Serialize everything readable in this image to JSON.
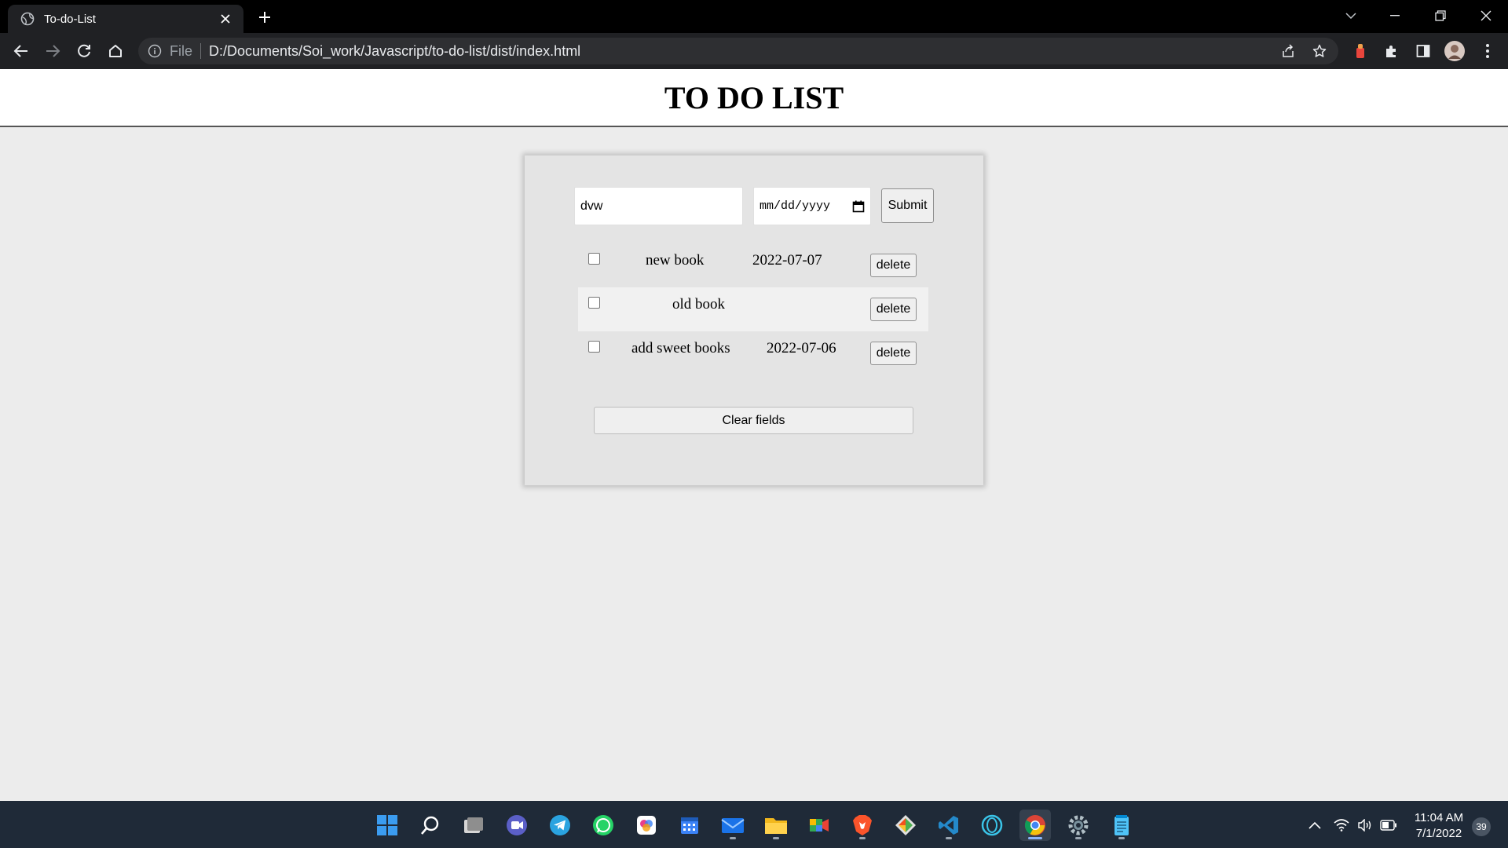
{
  "browser": {
    "tab_title": "To-do-List",
    "address_scheme": "File",
    "address_url": "D:/Documents/Soi_work/Javascript/to-do-list/dist/index.html"
  },
  "page": {
    "title": "TO DO LIST"
  },
  "form": {
    "task_value": "dvw",
    "date_placeholder": "mm/dd/yyyy",
    "submit_label": "Submit"
  },
  "tasks": [
    {
      "name": "new book",
      "date": "2022-07-07",
      "checked": false,
      "delete_label": "delete"
    },
    {
      "name": "old book",
      "date": "",
      "checked": false,
      "delete_label": "delete"
    },
    {
      "name": "add sweet books",
      "date": "2022-07-06",
      "checked": false,
      "delete_label": "delete"
    }
  ],
  "clear_label": "Clear fields",
  "taskbar": {
    "apps": [
      "windows-start",
      "search",
      "task-view",
      "teams-chat",
      "telegram",
      "whatsapp",
      "photos",
      "calendar",
      "mail",
      "file-explorer",
      "meet",
      "brave",
      "git",
      "vscode",
      "cortana",
      "chrome",
      "settings",
      "notepad"
    ],
    "time": "11:04 AM",
    "date": "7/1/2022",
    "notification_count": "39"
  }
}
